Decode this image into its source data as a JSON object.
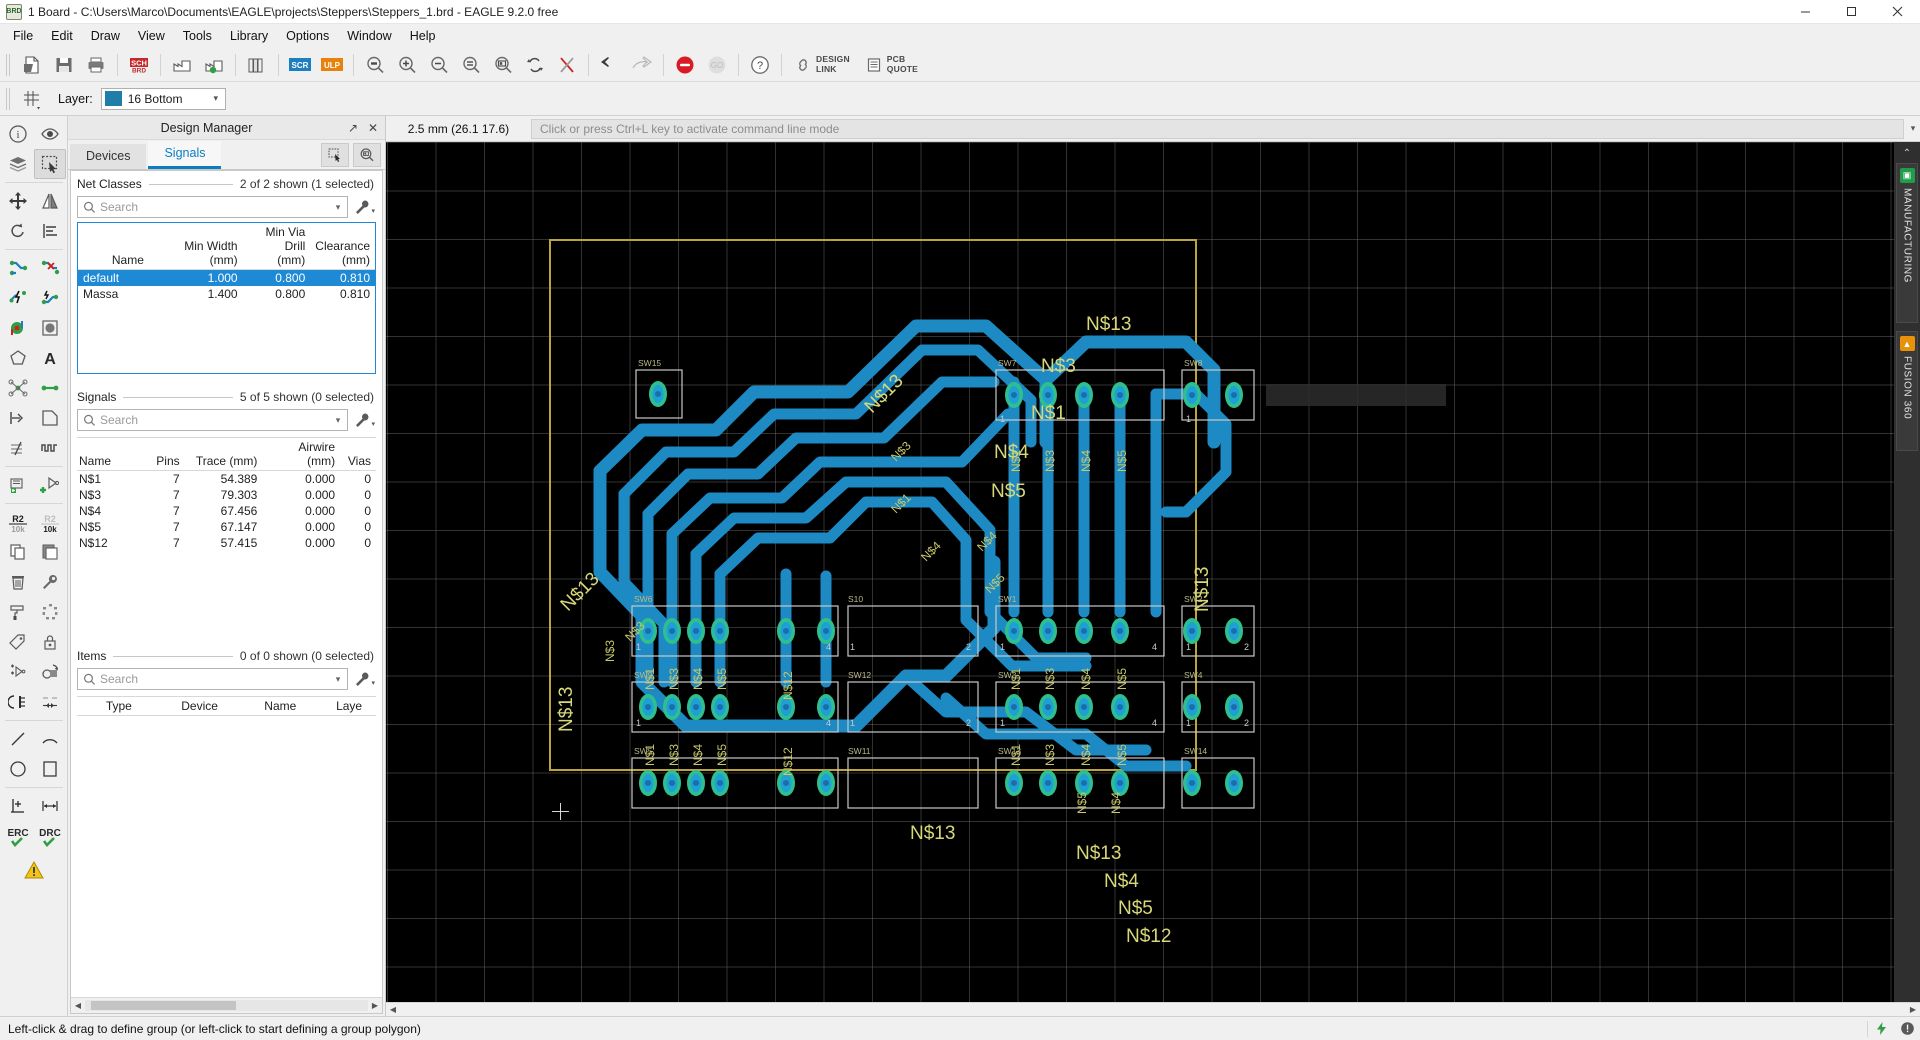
{
  "window": {
    "title": "1 Board - C:\\Users\\Marco\\Documents\\EAGLE\\projects\\Steppers\\Steppers_1.brd - EAGLE 9.2.0 free",
    "app_icon": "board-icon",
    "minimize": "–",
    "maximize": "❐",
    "close": "✕"
  },
  "menu": {
    "items": [
      {
        "label": "File"
      },
      {
        "label": "Edit"
      },
      {
        "label": "Draw"
      },
      {
        "label": "View"
      },
      {
        "label": "Tools"
      },
      {
        "label": "Library"
      },
      {
        "label": "Options"
      },
      {
        "label": "Window"
      },
      {
        "label": "Help"
      }
    ]
  },
  "toolbar": {
    "design_link": {
      "line1": "DESIGN",
      "line2": "LINK"
    },
    "pcb_quote": {
      "line1": "PCB",
      "line2": "QUOTE"
    },
    "sch_label": "SCH",
    "scr_label": "SCR",
    "ulp_label": "ULP"
  },
  "layerbar": {
    "label": "Layer:",
    "selected_layer": "16 Bottom",
    "swatch_color": "#1f7ea8",
    "arrow": "▾"
  },
  "design_manager": {
    "title": "Design Manager",
    "float_icon": "↗",
    "close_icon": "✕",
    "tabs": [
      {
        "label": "Devices",
        "active": false
      },
      {
        "label": "Signals",
        "active": true
      }
    ],
    "net_classes": {
      "label": "Net Classes",
      "count": "2 of 2 shown (1 selected)",
      "search_placeholder": "Search",
      "search_value": "",
      "columns": [
        "Name",
        "Min Width\n(mm)",
        "Min Via Drill\n(mm)",
        "Clearance\n(mm)"
      ],
      "columns_flat": [
        {
          "l1": "Name",
          "l2": ""
        },
        {
          "l1": "Min Width",
          "l2": "(mm)"
        },
        {
          "l1": "Min Via Drill",
          "l2": "(mm)"
        },
        {
          "l1": "Clearance",
          "l2": "(mm)"
        }
      ],
      "rows": [
        {
          "name": "default",
          "min_width": "1.000",
          "min_via_drill": "0.800",
          "clearance": "0.810",
          "selected": true
        },
        {
          "name": "Massa",
          "min_width": "1.400",
          "min_via_drill": "0.800",
          "clearance": "0.810",
          "selected": false
        }
      ]
    },
    "signals": {
      "label": "Signals",
      "count": "5 of 5 shown (0 selected)",
      "search_placeholder": "Search",
      "search_value": "",
      "columns": [
        "Name",
        "Pins",
        "Trace (mm)",
        "Airwire (mm)",
        "Vias"
      ],
      "sort_column": "Name",
      "rows": [
        {
          "name": "N$1",
          "pins": "7",
          "trace": "54.389",
          "airwire": "0.000",
          "vias": "0"
        },
        {
          "name": "N$3",
          "pins": "7",
          "trace": "79.303",
          "airwire": "0.000",
          "vias": "0"
        },
        {
          "name": "N$4",
          "pins": "7",
          "trace": "67.456",
          "airwire": "0.000",
          "vias": "0"
        },
        {
          "name": "N$5",
          "pins": "7",
          "trace": "67.147",
          "airwire": "0.000",
          "vias": "0"
        },
        {
          "name": "N$12",
          "pins": "7",
          "trace": "57.415",
          "airwire": "0.000",
          "vias": "0"
        }
      ]
    },
    "items": {
      "label": "Items",
      "count": "0 of 0 shown (0 selected)",
      "search_placeholder": "Search",
      "search_value": "",
      "columns": [
        "Type",
        "Device",
        "Name",
        "Laye"
      ],
      "sort_column": "Type",
      "rows": []
    }
  },
  "command_bar": {
    "coordinates": "2.5 mm (26.1 17.6)",
    "placeholder": "Click or press Ctrl+L key to activate command line mode",
    "value": "",
    "dropdown_arrow": "▾"
  },
  "canvas": {
    "board_color": "#bba43a",
    "trace_color": "#1e8ac4",
    "pad_color": "#34c08a",
    "label_color": "#d6d67a",
    "background": "#000000",
    "net_labels": [
      "N$13",
      "N$3",
      "N$1",
      "N$4",
      "N$5",
      "N$12"
    ],
    "component_prefix": "SW"
  },
  "right_dock": {
    "collapse_arrow": "⌃",
    "tabs": [
      {
        "label": "MANUFACTURING",
        "icon_color": "#1f9d4a",
        "icon": "chip-icon"
      },
      {
        "label": "FUSION 360",
        "icon_color": "#e8920c",
        "icon": "fusion-icon"
      }
    ]
  },
  "status_bar": {
    "message": "Left-click & drag to define group (or left-click to start defining a group polygon)",
    "icons": [
      "lightning-icon",
      "alert-icon"
    ]
  }
}
